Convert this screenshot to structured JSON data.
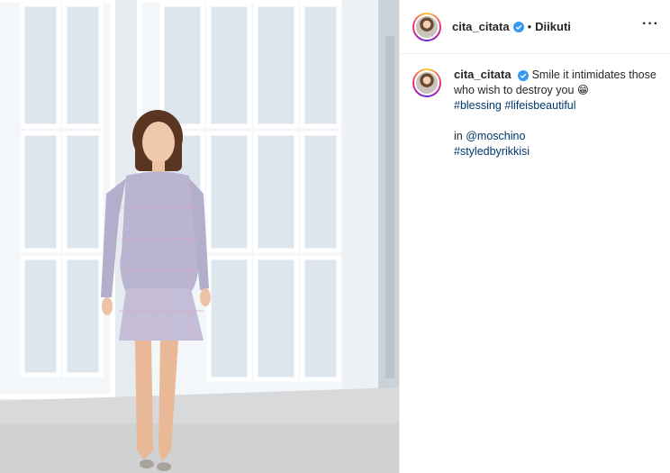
{
  "post": {
    "username": "cita_citata",
    "follow_status": "Diikuti",
    "more_icon": "more-options-icon"
  },
  "caption": {
    "username": "cita_citata",
    "text_line1": "Smile it intimidates those who wish to destroy you",
    "emoji": "😁",
    "hashtag1": "#blessing",
    "hashtag2": "#lifeisbeautiful",
    "in_label": "in",
    "mention": "@moschino",
    "hashtag3": "#styledbyrikkisi"
  },
  "colors": {
    "link": "#00376b",
    "verified": "#3897f0",
    "text": "#262626"
  }
}
